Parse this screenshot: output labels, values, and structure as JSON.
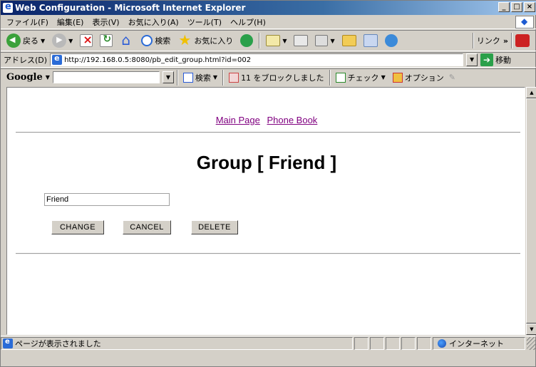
{
  "window": {
    "title": "Web Configuration - Microsoft Internet Explorer",
    "buttons": {
      "minimize": "_",
      "maximize": "□",
      "close": "×"
    }
  },
  "menu": {
    "items": [
      "ファイル(F)",
      "編集(E)",
      "表示(V)",
      "お気に入り(A)",
      "ツール(T)",
      "ヘルプ(H)"
    ]
  },
  "toolbar": {
    "back_label": "戻る",
    "search_label": "検索",
    "favorites_label": "お気に入り",
    "links_label": "リンク"
  },
  "address": {
    "label": "アドレス(D)",
    "url": "http://192.168.0.5:8080/pb_edit_group.html?id=002",
    "go_label": "移動"
  },
  "google": {
    "logo": "Google",
    "search_label": "検索",
    "blocked_label": "11 をブロックしました",
    "check_label": "チェック",
    "options_label": "オプション"
  },
  "page": {
    "links": [
      "Main Page",
      "Phone Book"
    ],
    "title": "Group [ Friend ]",
    "group_name_value": "Friend",
    "buttons": {
      "change": "CHANGE",
      "cancel": "CANCEL",
      "delete": "DELETE"
    }
  },
  "status": {
    "text": "ページが表示されました",
    "zone": "インターネット"
  }
}
